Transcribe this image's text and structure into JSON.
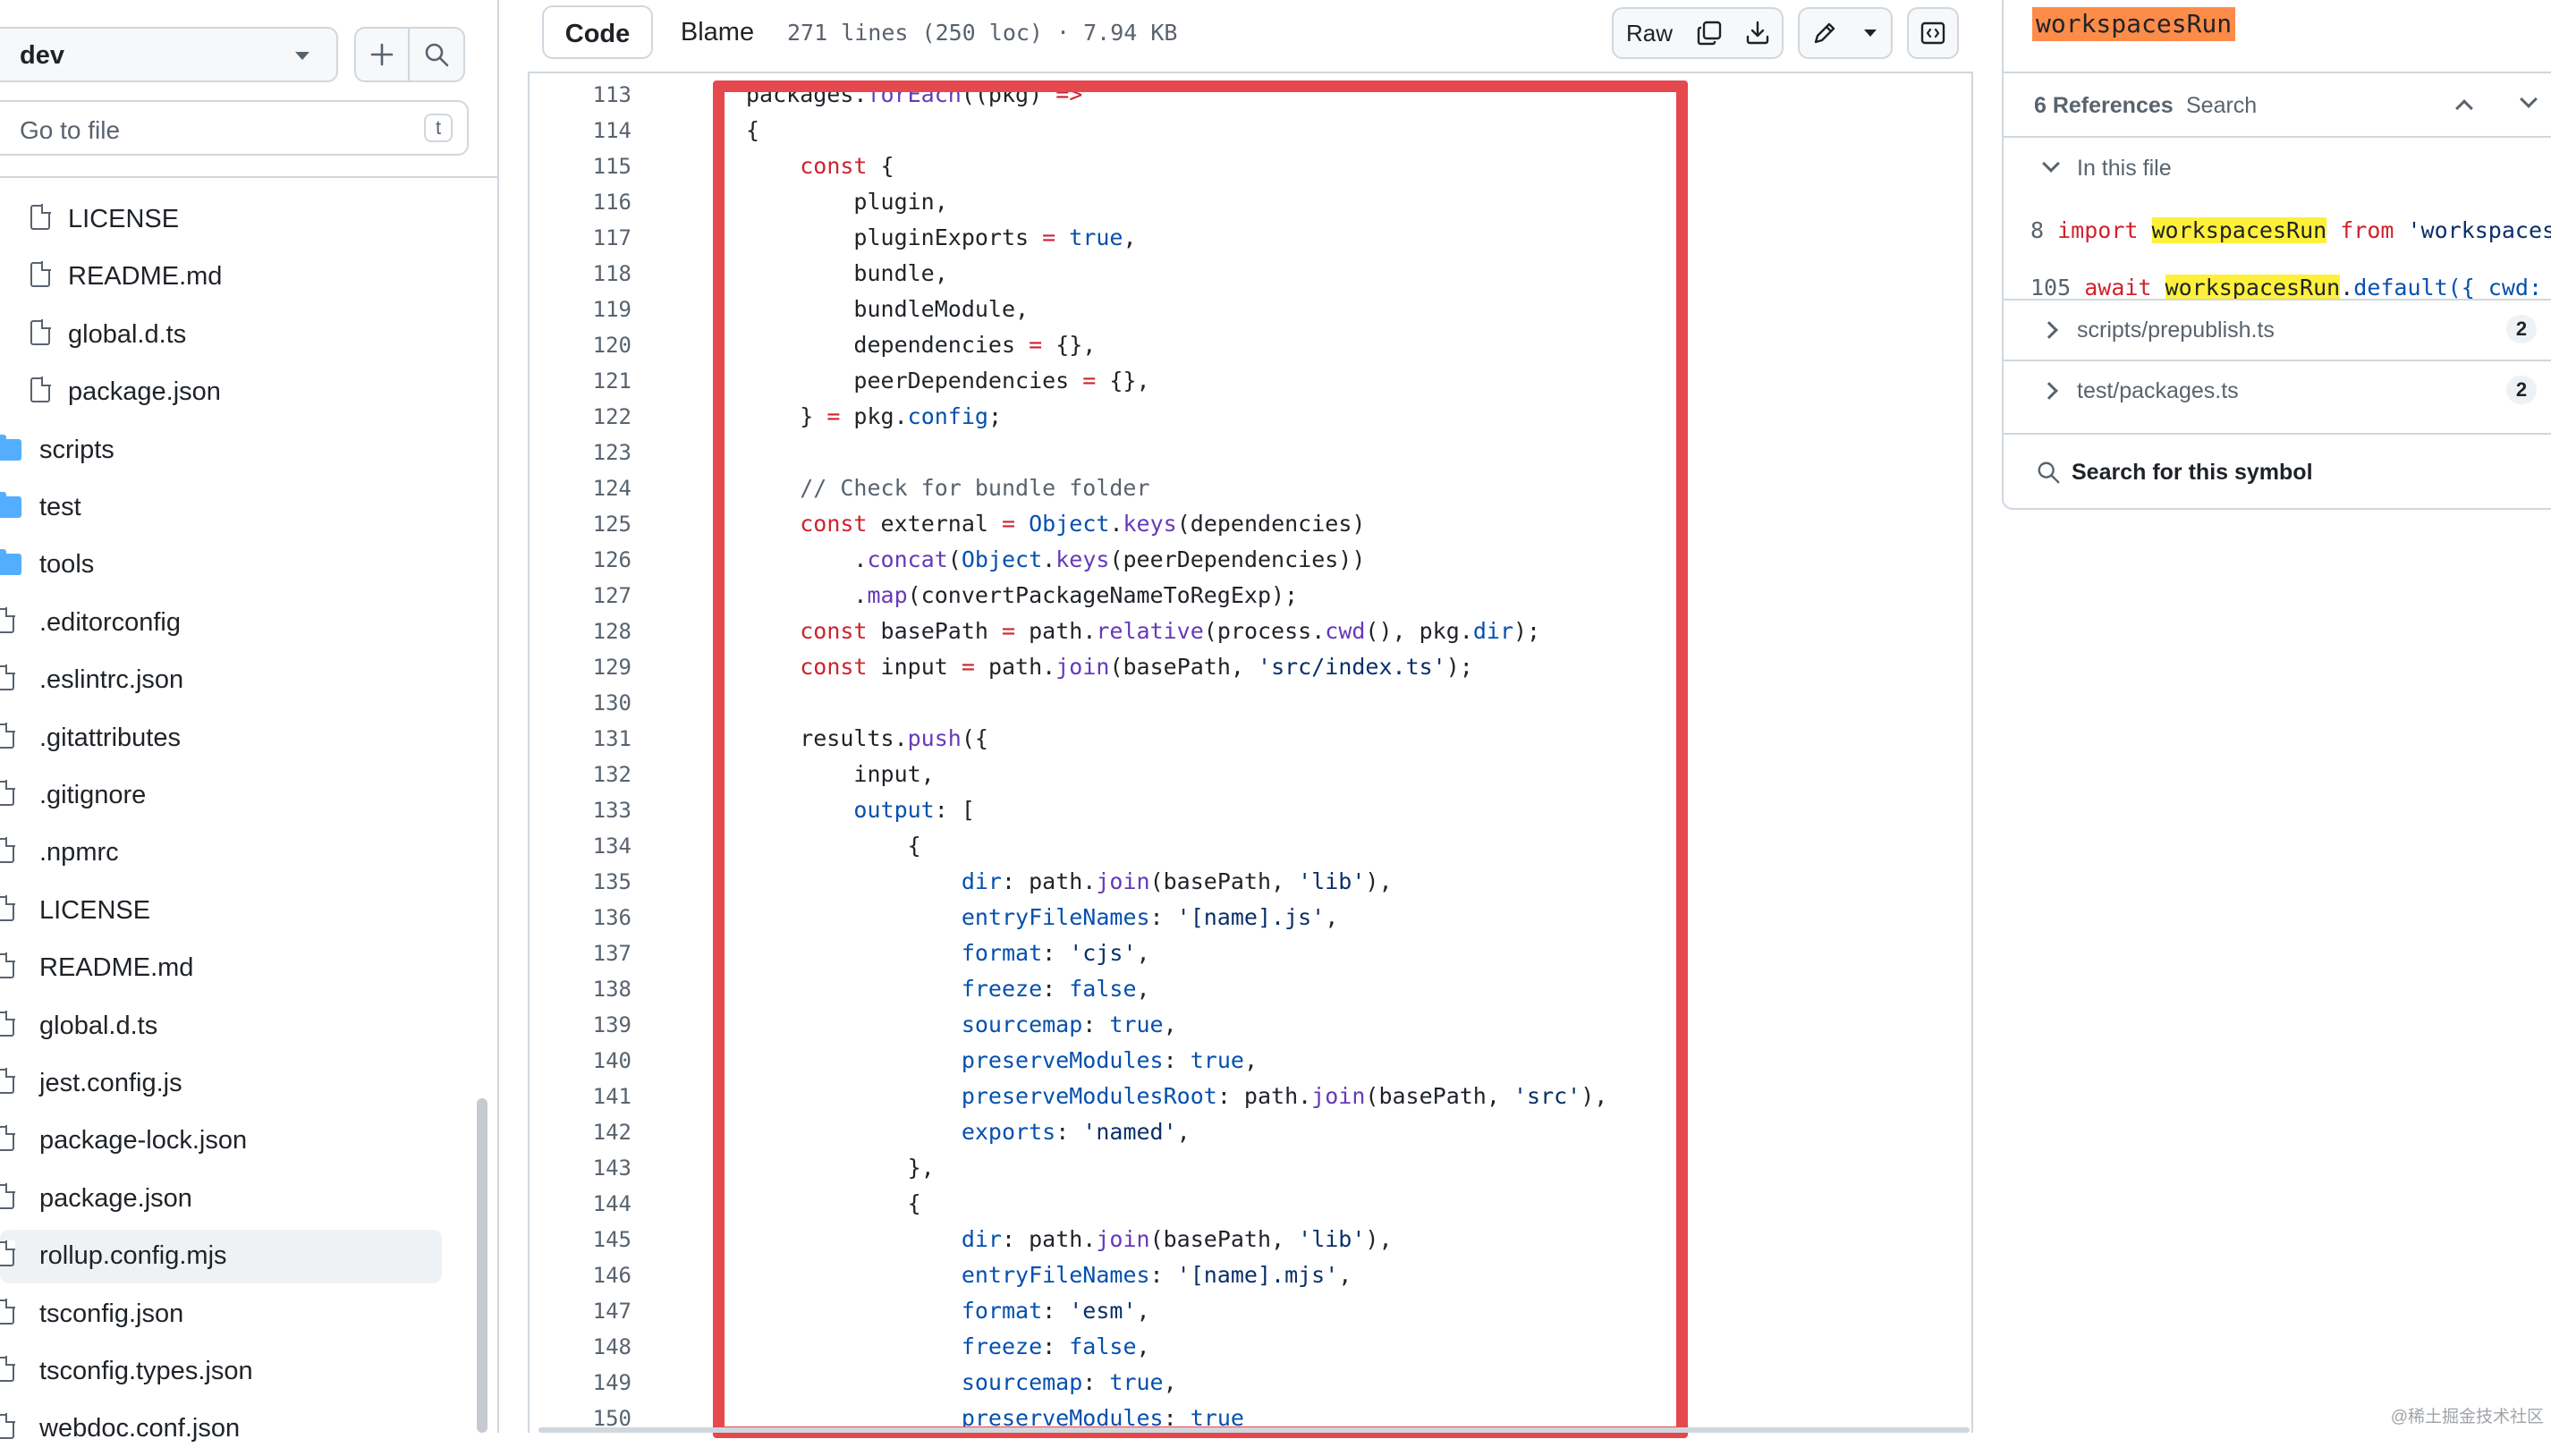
{
  "sidebar": {
    "branch": "dev",
    "goto_placeholder": "Go to file",
    "goto_shortcut": "t",
    "items": [
      {
        "label": "LICENSE",
        "type": "file",
        "depth": 1
      },
      {
        "label": "README.md",
        "type": "file",
        "depth": 1
      },
      {
        "label": "global.d.ts",
        "type": "file",
        "depth": 1
      },
      {
        "label": "package.json",
        "type": "file",
        "depth": 1
      },
      {
        "label": "scripts",
        "type": "folder",
        "depth": 0
      },
      {
        "label": "test",
        "type": "folder",
        "depth": 0
      },
      {
        "label": "tools",
        "type": "folder",
        "depth": 0
      },
      {
        "label": ".editorconfig",
        "type": "file",
        "depth": 0
      },
      {
        "label": ".eslintrc.json",
        "type": "file",
        "depth": 0
      },
      {
        "label": ".gitattributes",
        "type": "file",
        "depth": 0
      },
      {
        "label": ".gitignore",
        "type": "file",
        "depth": 0
      },
      {
        "label": ".npmrc",
        "type": "file",
        "depth": 0
      },
      {
        "label": "LICENSE",
        "type": "file",
        "depth": 0
      },
      {
        "label": "README.md",
        "type": "file",
        "depth": 0
      },
      {
        "label": "global.d.ts",
        "type": "file",
        "depth": 0
      },
      {
        "label": "jest.config.js",
        "type": "file",
        "depth": 0
      },
      {
        "label": "package-lock.json",
        "type": "file",
        "depth": 0
      },
      {
        "label": "package.json",
        "type": "file",
        "depth": 0
      },
      {
        "label": "rollup.config.mjs",
        "type": "file",
        "depth": 0,
        "active": true
      },
      {
        "label": "tsconfig.json",
        "type": "file",
        "depth": 0
      },
      {
        "label": "tsconfig.types.json",
        "type": "file",
        "depth": 0
      },
      {
        "label": "webdoc.conf.json",
        "type": "file",
        "depth": 0
      }
    ]
  },
  "toolbar": {
    "tab_code": "Code",
    "tab_blame": "Blame",
    "file_meta": "271 lines (250 loc) · 7.94 KB",
    "raw_label": "Raw"
  },
  "code": {
    "lines": [
      {
        "n": "113",
        "t": [
          [
            "packages.",
            "x"
          ],
          [
            "forEach",
            "fn"
          ],
          [
            "((pkg) ",
            "x"
          ],
          [
            "=>",
            "kw"
          ]
        ]
      },
      {
        "n": "114",
        "t": [
          [
            "{",
            "x"
          ]
        ]
      },
      {
        "n": "115",
        "t": [
          [
            "    ",
            "x"
          ],
          [
            "const",
            "kw"
          ],
          [
            " {",
            "x"
          ]
        ]
      },
      {
        "n": "116",
        "t": [
          [
            "        plugin,",
            "x"
          ]
        ]
      },
      {
        "n": "117",
        "t": [
          [
            "        pluginExports ",
            "x"
          ],
          [
            "=",
            "kw"
          ],
          [
            " ",
            "x"
          ],
          [
            "true",
            "pr"
          ],
          [
            ",",
            "x"
          ]
        ]
      },
      {
        "n": "118",
        "t": [
          [
            "        bundle,",
            "x"
          ]
        ]
      },
      {
        "n": "119",
        "t": [
          [
            "        bundleModule,",
            "x"
          ]
        ]
      },
      {
        "n": "120",
        "t": [
          [
            "        dependencies ",
            "x"
          ],
          [
            "=",
            "kw"
          ],
          [
            " {},",
            "x"
          ]
        ]
      },
      {
        "n": "121",
        "t": [
          [
            "        peerDependencies ",
            "x"
          ],
          [
            "=",
            "kw"
          ],
          [
            " {},",
            "x"
          ]
        ]
      },
      {
        "n": "122",
        "t": [
          [
            "    } ",
            "x"
          ],
          [
            "=",
            "kw"
          ],
          [
            " pkg.",
            "x"
          ],
          [
            "config",
            "pr"
          ],
          [
            ";",
            "x"
          ]
        ]
      },
      {
        "n": "123",
        "t": [
          [
            "",
            "x"
          ]
        ]
      },
      {
        "n": "124",
        "t": [
          [
            "    // Check for bundle folder",
            "cm"
          ]
        ]
      },
      {
        "n": "125",
        "t": [
          [
            "    ",
            "x"
          ],
          [
            "const",
            "kw"
          ],
          [
            " external ",
            "x"
          ],
          [
            "=",
            "kw"
          ],
          [
            " ",
            "x"
          ],
          [
            "Object",
            "pr"
          ],
          [
            ".",
            "x"
          ],
          [
            "keys",
            "fn"
          ],
          [
            "(dependencies)",
            "x"
          ]
        ]
      },
      {
        "n": "126",
        "t": [
          [
            "        .",
            "x"
          ],
          [
            "concat",
            "fn"
          ],
          [
            "(",
            "x"
          ],
          [
            "Object",
            "pr"
          ],
          [
            ".",
            "x"
          ],
          [
            "keys",
            "fn"
          ],
          [
            "(peerDependencies))",
            "x"
          ]
        ]
      },
      {
        "n": "127",
        "t": [
          [
            "        .",
            "x"
          ],
          [
            "map",
            "fn"
          ],
          [
            "(convertPackageNameToRegExp);",
            "x"
          ]
        ]
      },
      {
        "n": "128",
        "t": [
          [
            "    ",
            "x"
          ],
          [
            "const",
            "kw"
          ],
          [
            " basePath ",
            "x"
          ],
          [
            "=",
            "kw"
          ],
          [
            " path.",
            "x"
          ],
          [
            "relative",
            "fn"
          ],
          [
            "(process.",
            "x"
          ],
          [
            "cwd",
            "fn"
          ],
          [
            "(), pkg.",
            "x"
          ],
          [
            "dir",
            "pr"
          ],
          [
            ");",
            "x"
          ]
        ]
      },
      {
        "n": "129",
        "t": [
          [
            "    ",
            "x"
          ],
          [
            "const",
            "kw"
          ],
          [
            " input ",
            "x"
          ],
          [
            "=",
            "kw"
          ],
          [
            " path.",
            "x"
          ],
          [
            "join",
            "fn"
          ],
          [
            "(basePath, ",
            "x"
          ],
          [
            "'src/index.ts'",
            "st"
          ],
          [
            ");",
            "x"
          ]
        ]
      },
      {
        "n": "130",
        "t": [
          [
            "",
            "x"
          ]
        ]
      },
      {
        "n": "131",
        "t": [
          [
            "    results.",
            "x"
          ],
          [
            "push",
            "fn"
          ],
          [
            "({",
            "x"
          ]
        ]
      },
      {
        "n": "132",
        "t": [
          [
            "        input,",
            "x"
          ]
        ]
      },
      {
        "n": "133",
        "t": [
          [
            "        ",
            "x"
          ],
          [
            "output",
            "pr"
          ],
          [
            ": [",
            "x"
          ]
        ]
      },
      {
        "n": "134",
        "t": [
          [
            "            {",
            "x"
          ]
        ]
      },
      {
        "n": "135",
        "t": [
          [
            "                ",
            "x"
          ],
          [
            "dir",
            "pr"
          ],
          [
            ": path.",
            "x"
          ],
          [
            "join",
            "fn"
          ],
          [
            "(basePath, ",
            "x"
          ],
          [
            "'lib'",
            "st"
          ],
          [
            "),",
            "x"
          ]
        ]
      },
      {
        "n": "136",
        "t": [
          [
            "                ",
            "x"
          ],
          [
            "entryFileNames",
            "pr"
          ],
          [
            ": ",
            "x"
          ],
          [
            "'[name].js'",
            "st"
          ],
          [
            ",",
            "x"
          ]
        ]
      },
      {
        "n": "137",
        "t": [
          [
            "                ",
            "x"
          ],
          [
            "format",
            "pr"
          ],
          [
            ": ",
            "x"
          ],
          [
            "'cjs'",
            "st"
          ],
          [
            ",",
            "x"
          ]
        ]
      },
      {
        "n": "138",
        "t": [
          [
            "                ",
            "x"
          ],
          [
            "freeze",
            "pr"
          ],
          [
            ": ",
            "x"
          ],
          [
            "false",
            "pr"
          ],
          [
            ",",
            "x"
          ]
        ]
      },
      {
        "n": "139",
        "t": [
          [
            "                ",
            "x"
          ],
          [
            "sourcemap",
            "pr"
          ],
          [
            ": ",
            "x"
          ],
          [
            "true",
            "pr"
          ],
          [
            ",",
            "x"
          ]
        ]
      },
      {
        "n": "140",
        "t": [
          [
            "                ",
            "x"
          ],
          [
            "preserveModules",
            "pr"
          ],
          [
            ": ",
            "x"
          ],
          [
            "true",
            "pr"
          ],
          [
            ",",
            "x"
          ]
        ]
      },
      {
        "n": "141",
        "t": [
          [
            "                ",
            "x"
          ],
          [
            "preserveModulesRoot",
            "pr"
          ],
          [
            ": path.",
            "x"
          ],
          [
            "join",
            "fn"
          ],
          [
            "(basePath, ",
            "x"
          ],
          [
            "'src'",
            "st"
          ],
          [
            "),",
            "x"
          ]
        ]
      },
      {
        "n": "142",
        "t": [
          [
            "                ",
            "x"
          ],
          [
            "exports",
            "pr"
          ],
          [
            ": ",
            "x"
          ],
          [
            "'named'",
            "st"
          ],
          [
            ",",
            "x"
          ]
        ]
      },
      {
        "n": "143",
        "t": [
          [
            "            },",
            "x"
          ]
        ]
      },
      {
        "n": "144",
        "t": [
          [
            "            {",
            "x"
          ]
        ]
      },
      {
        "n": "145",
        "t": [
          [
            "                ",
            "x"
          ],
          [
            "dir",
            "pr"
          ],
          [
            ": path.",
            "x"
          ],
          [
            "join",
            "fn"
          ],
          [
            "(basePath, ",
            "x"
          ],
          [
            "'lib'",
            "st"
          ],
          [
            "),",
            "x"
          ]
        ]
      },
      {
        "n": "146",
        "t": [
          [
            "                ",
            "x"
          ],
          [
            "entryFileNames",
            "pr"
          ],
          [
            ": ",
            "x"
          ],
          [
            "'[name].mjs'",
            "st"
          ],
          [
            ",",
            "x"
          ]
        ]
      },
      {
        "n": "147",
        "t": [
          [
            "                ",
            "x"
          ],
          [
            "format",
            "pr"
          ],
          [
            ": ",
            "x"
          ],
          [
            "'esm'",
            "st"
          ],
          [
            ",",
            "x"
          ]
        ]
      },
      {
        "n": "148",
        "t": [
          [
            "                ",
            "x"
          ],
          [
            "freeze",
            "pr"
          ],
          [
            ": ",
            "x"
          ],
          [
            "false",
            "pr"
          ],
          [
            ",",
            "x"
          ]
        ]
      },
      {
        "n": "149",
        "t": [
          [
            "                ",
            "x"
          ],
          [
            "sourcemap",
            "pr"
          ],
          [
            ": ",
            "x"
          ],
          [
            "true",
            "pr"
          ],
          [
            ",",
            "x"
          ]
        ]
      },
      {
        "n": "150",
        "t": [
          [
            "                ",
            "x"
          ],
          [
            "preserveModules",
            "pr"
          ],
          [
            ": ",
            "x"
          ],
          [
            "true",
            "pr"
          ]
        ]
      }
    ]
  },
  "symbols": {
    "name": "workspacesRun",
    "refs_count": "6 References",
    "refs_search": "Search",
    "in_file_label": "In this file",
    "refs": [
      {
        "line": "8",
        "pre": [
          [
            "import",
            "kw"
          ],
          [
            " ",
            "x"
          ]
        ],
        "match": "workspacesRun",
        "post": [
          [
            " from ",
            "kw"
          ],
          [
            "'workspaces-",
            "st"
          ]
        ]
      },
      {
        "line": "105",
        "pre": [
          [
            "await",
            "kw"
          ],
          [
            " ",
            "x"
          ]
        ],
        "match": "workspacesRun",
        "post": [
          [
            ".",
            "x"
          ],
          [
            "default",
            "pr"
          ],
          [
            "({ cwd: p",
            "pr"
          ]
        ]
      }
    ],
    "files": [
      {
        "name": "scripts/prepublish.ts",
        "count": "2"
      },
      {
        "name": "test/packages.ts",
        "count": "2"
      }
    ],
    "search_symbol_label": "Search for this symbol"
  },
  "colors": {
    "accent_highlight_box": "#e5484d",
    "symbol_name_bg": "#fd8c49",
    "match_bg": "#fff13b",
    "folder": "#54aeff"
  },
  "watermark": "@稀土掘金技术社区"
}
